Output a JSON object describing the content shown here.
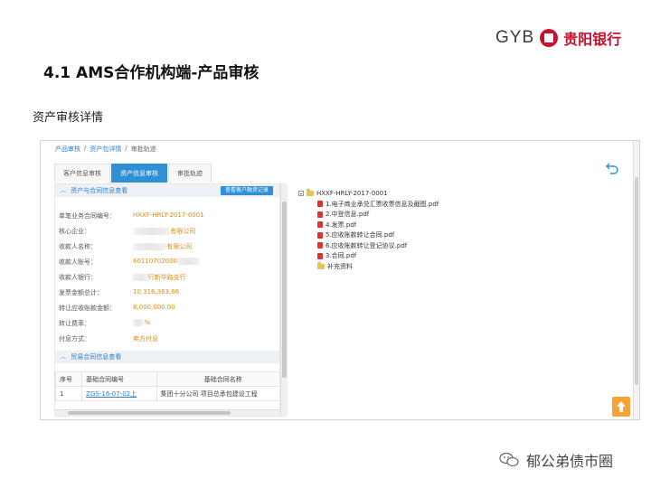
{
  "brand": {
    "latin": "GYB",
    "cn": "贵阳银行"
  },
  "slide": {
    "title": "4.1  AMS合作机构端-产品审核",
    "subtitle": "资产审核详情"
  },
  "breadcrumb": [
    "产品审核",
    "资产包详情",
    "审批轨迹"
  ],
  "tabs": [
    {
      "label": "客户信息审核",
      "active": false
    },
    {
      "label": "资产信息审核",
      "active": true
    },
    {
      "label": "审批轨迹",
      "active": false
    }
  ],
  "asset_section": {
    "title": "资产与合同信息查看",
    "button": "查看客户融资记录",
    "fields": [
      {
        "label": "单笔业务合同编号：",
        "value": "HXXF-HRLY-2017-0001"
      },
      {
        "label": "核心企业：",
        "value": "有限公司"
      },
      {
        "label": "收款人名称：",
        "value": "有限公司"
      },
      {
        "label": "收款人账号：",
        "value": "60110702000"
      },
      {
        "label": "收款人银行：",
        "value": "行新华路支行"
      },
      {
        "label": "发票金额总计：",
        "value": "10,316,363.66"
      },
      {
        "label": "转让应收账款金额：",
        "value": "8,000,000.00"
      },
      {
        "label": "转让费率：",
        "value": "%"
      },
      {
        "label": "付息方式：",
        "value": "卖方付息"
      }
    ]
  },
  "trade_section": {
    "title": "贸易合同信息查看",
    "headers": [
      "序号",
      "基础合同编号",
      "基础合同名称"
    ],
    "rows": [
      {
        "no": "1",
        "code": "ZGS-16-07-02上",
        "name": "集团十分公司  项目总承包建设工程"
      }
    ]
  },
  "tree": {
    "root": "HXXF-HRLY-2017-0001",
    "items": [
      {
        "label": "1.电子商业承兑汇票收票信息及截图.pdf",
        "kind": "pdf"
      },
      {
        "label": "2.中登信息.pdf",
        "kind": "pdf"
      },
      {
        "label": "4.发票.pdf",
        "kind": "pdf"
      },
      {
        "label": "5.应收账款转让合同.pdf",
        "kind": "pdf"
      },
      {
        "label": "6.应收账款转让登记协议.pdf",
        "kind": "pdf"
      },
      {
        "label": "3.合同.pdf",
        "kind": "pdf"
      },
      {
        "label": "补充资料",
        "kind": "folder"
      }
    ]
  },
  "watermark": "郁公弟债市圈",
  "colors": {
    "brand_red": "#c8102e",
    "tab_active": "#2f90d8",
    "value_orange": "#d98c1a",
    "link": "#2d7fd0"
  }
}
